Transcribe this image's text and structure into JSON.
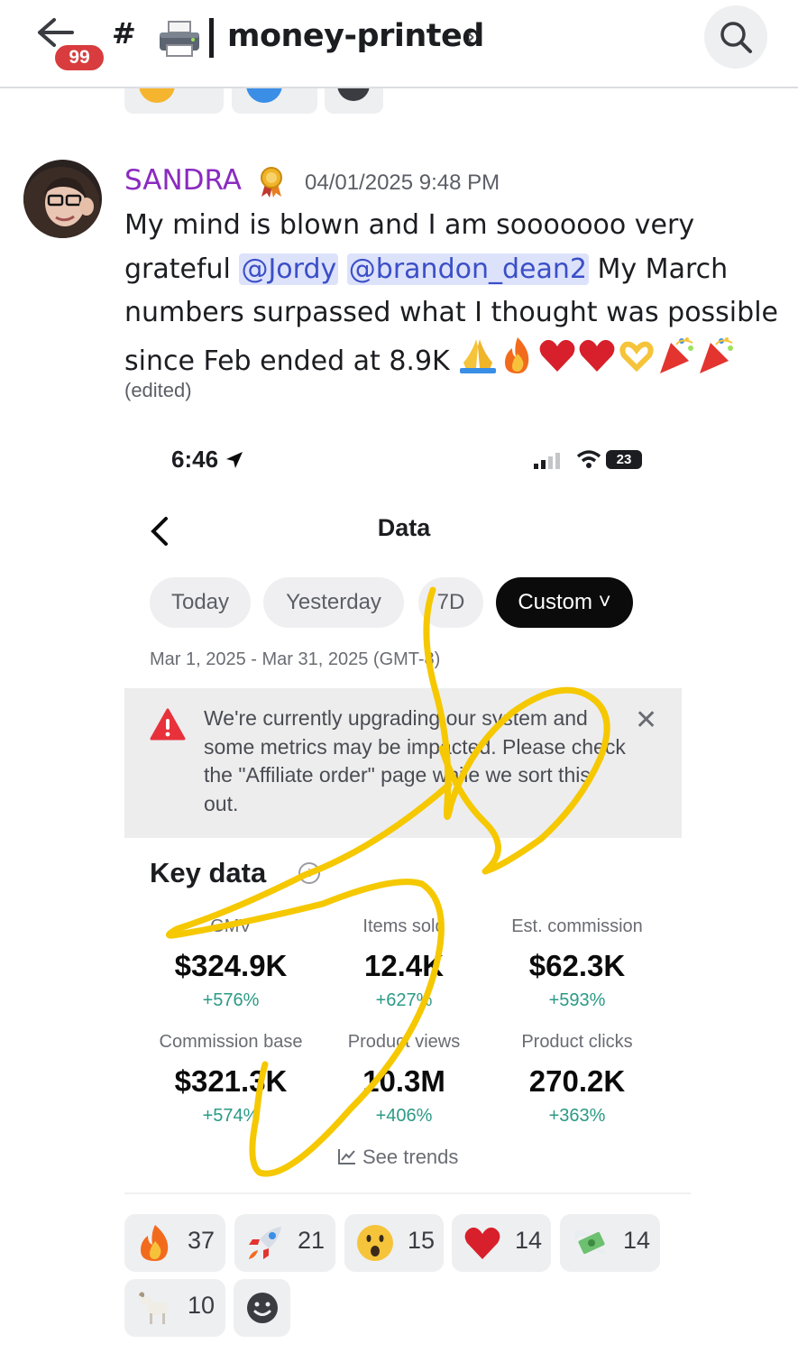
{
  "header": {
    "unread_badge": "99",
    "channel_prefix": "#",
    "channel_name": "money-printed",
    "chevron": "›",
    "icons": [
      "back-arrow-icon",
      "lock-hash-icon",
      "printer-icon",
      "search-icon"
    ]
  },
  "message": {
    "author": "SANDRA",
    "author_color": "#8a2bbf",
    "role_icon": "medal-icon",
    "timestamp": "04/01/2025 9:48 PM",
    "text_before": "My mind is blown and I am sooooooo very grateful ",
    "mention_1": "@Jordy",
    "mention_2": "@brandon_dean2",
    "text_after": " My March numbers surpassed what I thought was possible since Feb ended at 8.9K ",
    "emojis": [
      "pray-emoji",
      "fire-emoji",
      "heart-emoji",
      "heart-emoji",
      "heart-hands-emoji",
      "party-popper-emoji",
      "party-popper-emoji"
    ],
    "edited": "(edited)"
  },
  "screenshot": {
    "status_time": "6:46",
    "battery": "23",
    "page_title": "Data",
    "tabs": [
      {
        "label": "Today",
        "active": false
      },
      {
        "label": "Yesterday",
        "active": false
      },
      {
        "label": "7D",
        "active": false
      },
      {
        "label": "Custom ˅",
        "active": true
      }
    ],
    "date_range": "Mar 1, 2025 - Mar 31, 2025 (GMT-8)",
    "banner_text": "We're currently upgrading our system and some metrics may be impacted. Please check the \"Affiliate order\" page while we sort this out.",
    "banner_close": "✕",
    "key_data_title": "Key data",
    "metrics": [
      {
        "label": "GMV",
        "value": "$324.9K",
        "change": "+576%"
      },
      {
        "label": "Items sold",
        "value": "12.4K",
        "change": "+627%"
      },
      {
        "label": "Est. commission",
        "value": "$62.3K",
        "change": "+593%"
      },
      {
        "label": "Commission base",
        "value": "$321.3K",
        "change": "+574%"
      },
      {
        "label": "Product views",
        "value": "10.3M",
        "change": "+406%"
      },
      {
        "label": "Product clicks",
        "value": "270.2K",
        "change": "+363%"
      }
    ],
    "see_trends": "See trends",
    "accent_color": "#2b9a86",
    "scribble_color": "#f5c800"
  },
  "reactions": [
    {
      "emoji": "fire-emoji",
      "count": "37"
    },
    {
      "emoji": "rocket-emoji",
      "count": "21"
    },
    {
      "emoji": "astonished-emoji",
      "count": "15"
    },
    {
      "emoji": "heart-emoji",
      "count": "14"
    },
    {
      "emoji": "money-wings-emoji",
      "count": "14"
    },
    {
      "emoji": "goat-emoji",
      "count": "10"
    },
    {
      "emoji": "add-reaction-icon",
      "count": ""
    }
  ]
}
